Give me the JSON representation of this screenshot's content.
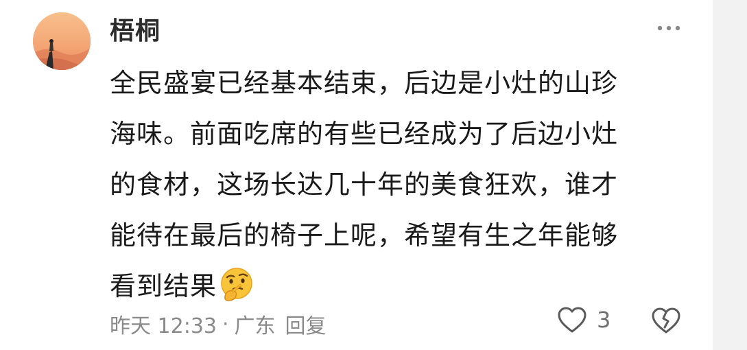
{
  "comment": {
    "username": "梧桐",
    "text_lines": [
      "全民盛宴已经基本结束，后边是小灶的山珍",
      "海味。前面吃席的有些已经成为了后边小灶",
      "的食材，这场长达几十年的美食狂欢，谁才",
      "能待在最后的椅子上呢，希望有生之年能够",
      "看到结果"
    ],
    "emoji": "thinking-face",
    "time": "昨天 12:33",
    "separator": "·",
    "location": "广东",
    "reply_label": "回复",
    "like_count": "3"
  },
  "icons": {
    "more": "more-dots-icon",
    "like": "heart-outline-icon",
    "dislike": "broken-heart-icon"
  },
  "colors": {
    "text": "#1a1a1a",
    "meta": "#8a8a8a",
    "icon": "#5a5a5a"
  }
}
